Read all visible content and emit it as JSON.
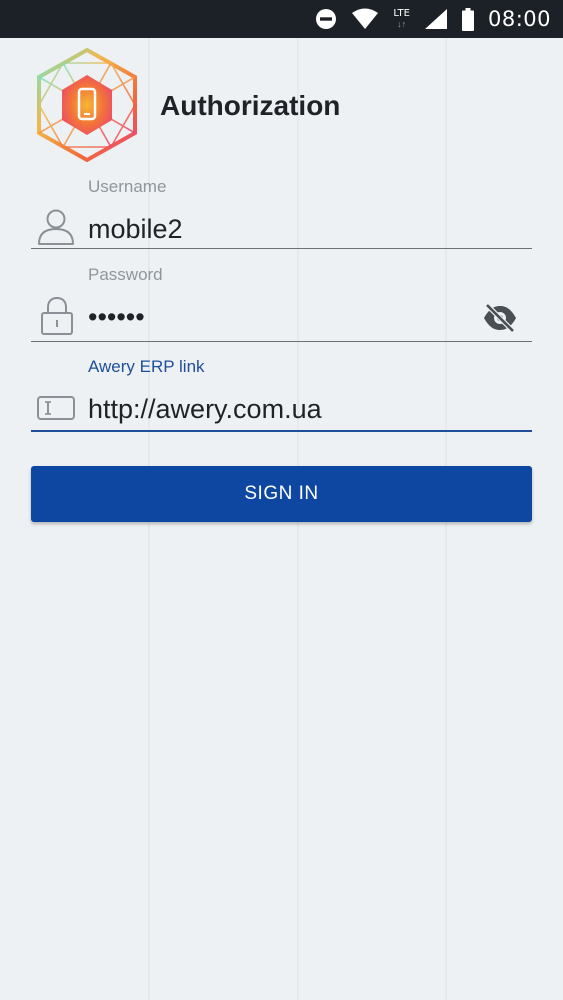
{
  "status_bar": {
    "time": "08:00",
    "network_label": "LTE",
    "network_arrows": "↓↑",
    "icons": [
      "do-not-disturb-icon",
      "wifi-icon",
      "cell-signal-icon",
      "battery-icon"
    ]
  },
  "header": {
    "title": "Authorization",
    "logo_icon": "hexagon-phone-logo"
  },
  "form": {
    "username": {
      "label": "Username",
      "value": "mobile2",
      "icon": "user-icon"
    },
    "password": {
      "label": "Password",
      "value": "••••••",
      "icon": "lock-icon",
      "toggle_icon": "eye-off-icon"
    },
    "erp_link": {
      "label": "Awery ERP link",
      "value": "http://awery.com.ua",
      "icon": "text-field-icon"
    },
    "submit_label": "SIGN IN"
  },
  "colors": {
    "primary": "#0d47a1",
    "accent_text": "#1f4f9a",
    "background": "#edf1f3",
    "status_bar": "#1c2127",
    "label_gray": "#8f969c"
  }
}
